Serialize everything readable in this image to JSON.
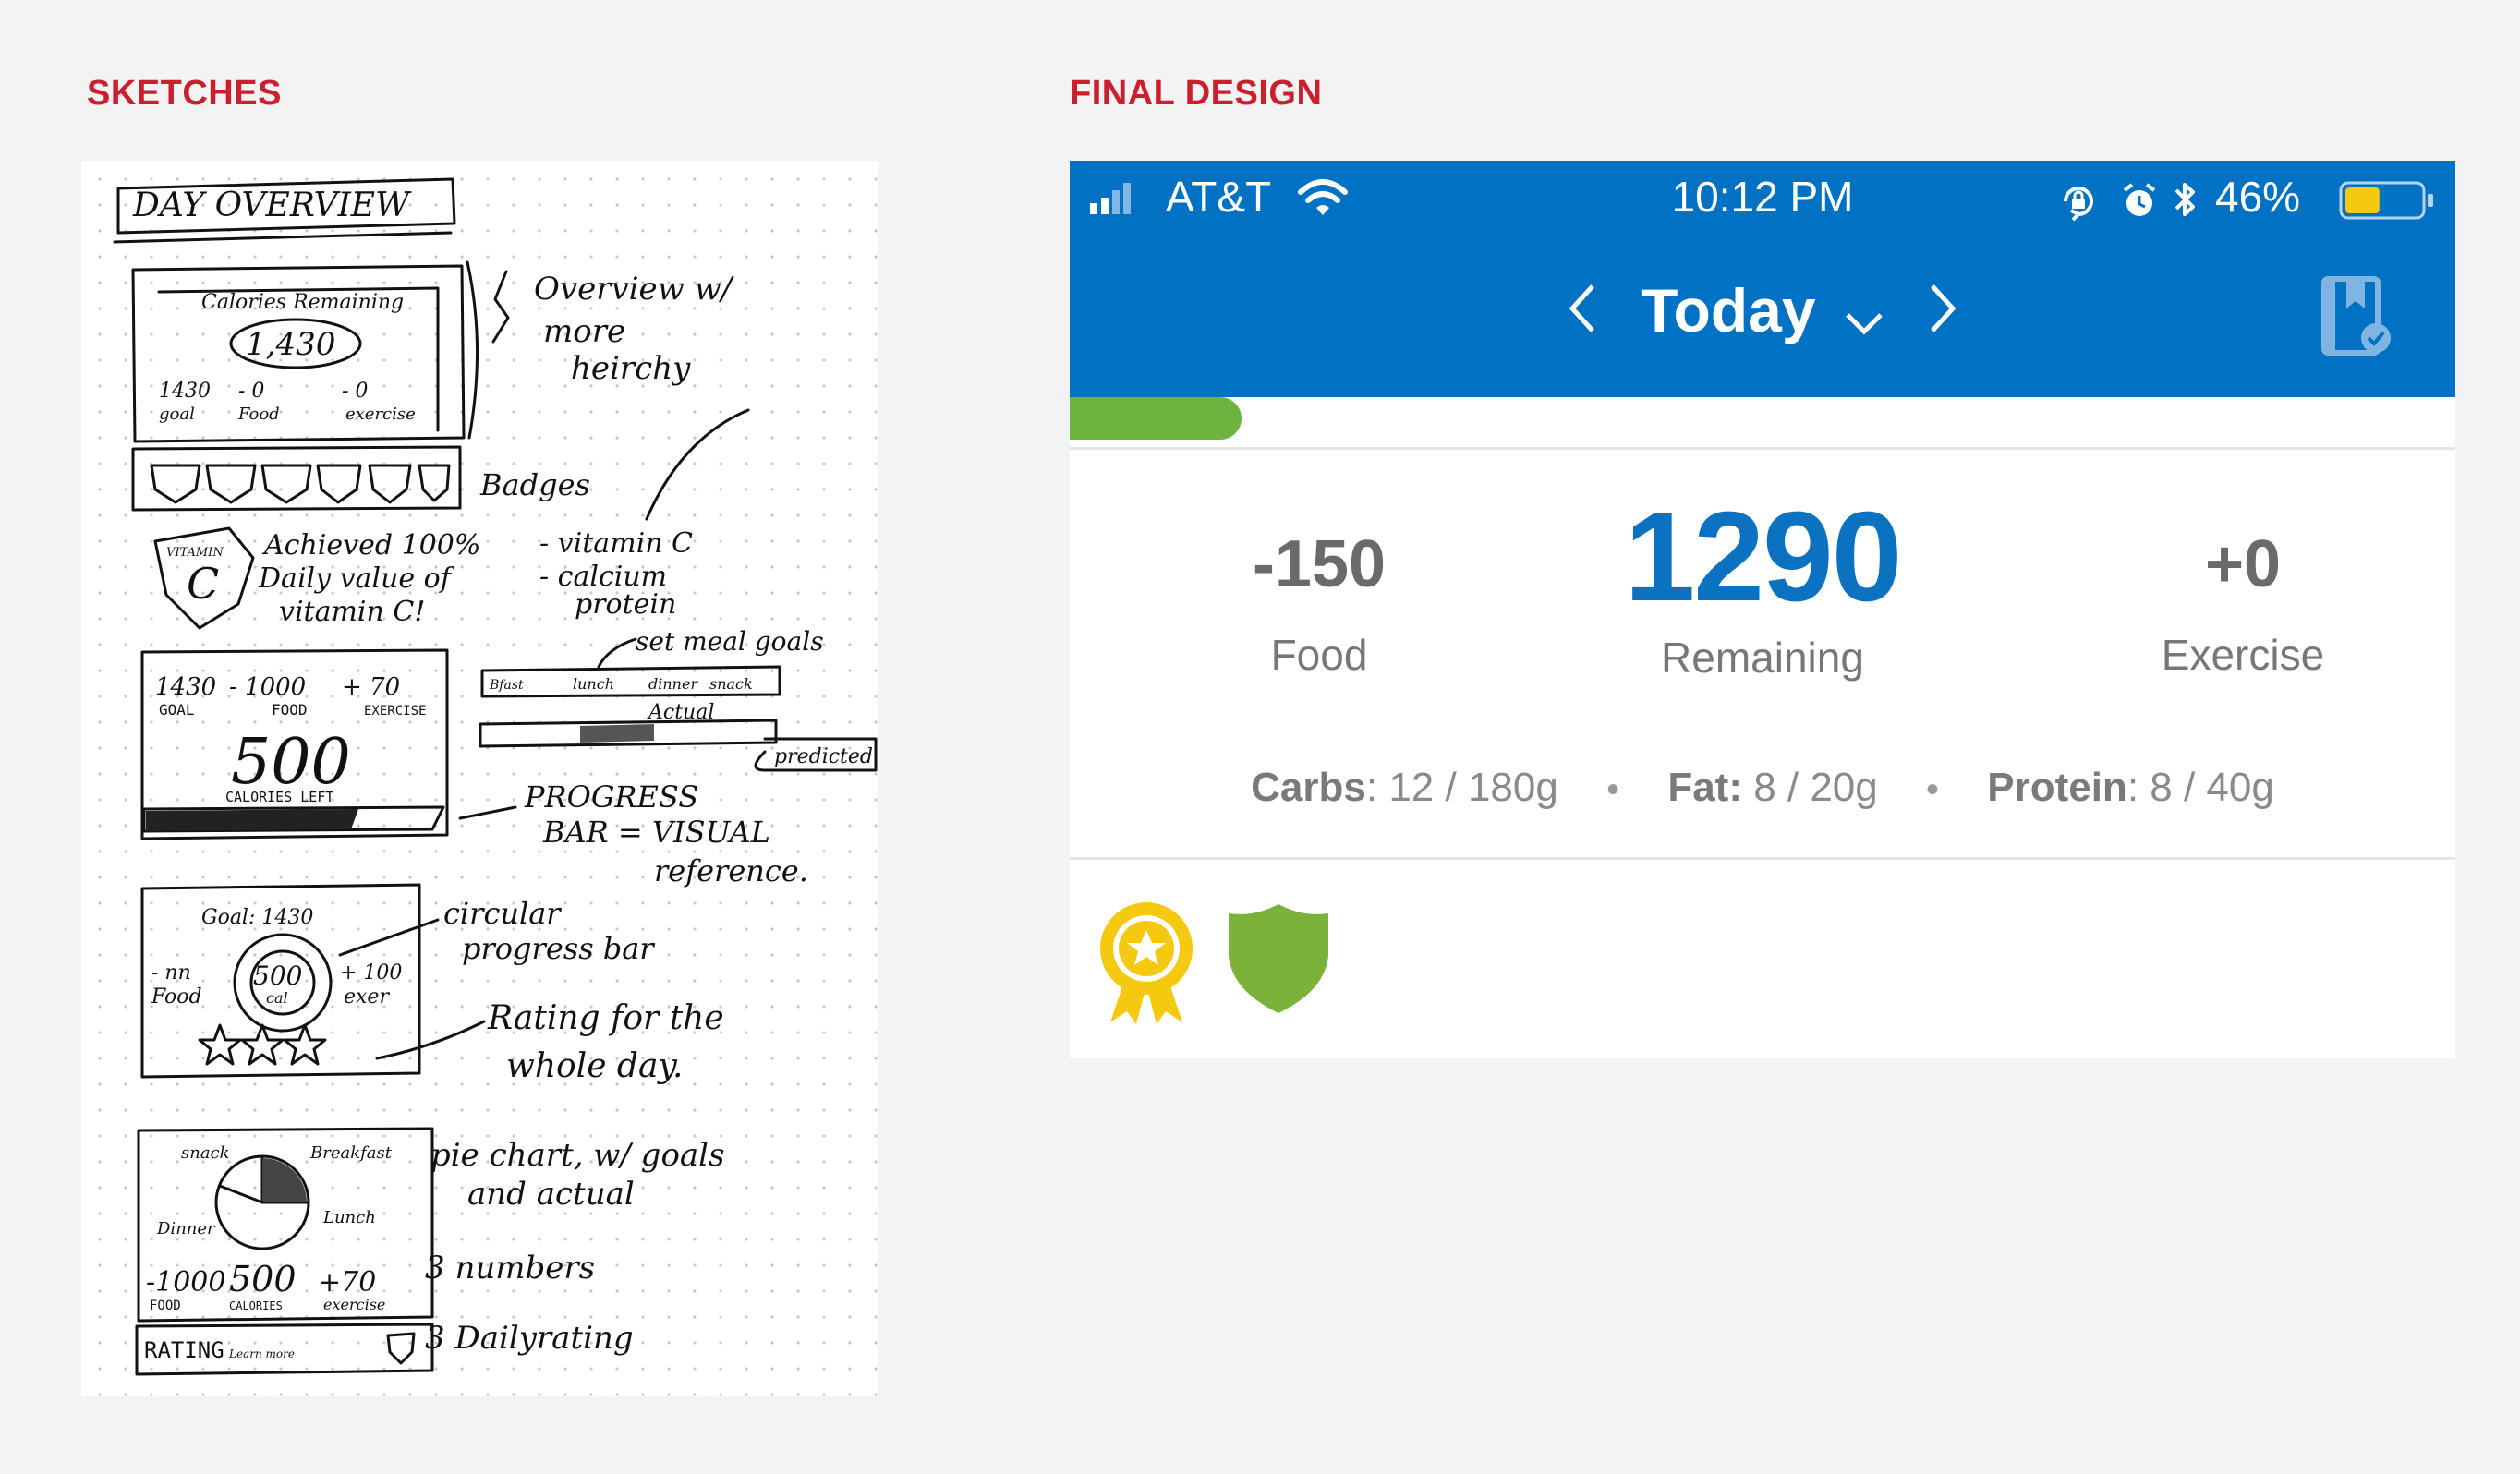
{
  "labels": {
    "sketches": "SKETCHES",
    "final_design": "FINAL DESIGN"
  },
  "sketch": {
    "title": "DAY OVERVIEW",
    "s1": {
      "label": "Calories Remaining",
      "value": "1,430",
      "goal": "1430",
      "goal_lbl": "goal",
      "food": "- 0",
      "food_lbl": "Food",
      "exercise": "- 0",
      "exercise_lbl": "exercise",
      "note1": "Overview w/",
      "note2": "more",
      "note3": "heirchy"
    },
    "badges": {
      "label": "Badges",
      "achieved1": "Achieved 100%",
      "achieved2": "Daily value of",
      "achieved3": "vitamin C!",
      "list1": "- vitamin C",
      "list2": "- calcium",
      "list3": "protein",
      "badge_text": "VITAMIN"
    },
    "s2": {
      "goal": "1430",
      "goal_lbl": "GOAL",
      "food": "- 1000",
      "food_lbl": "FOOD",
      "ex": "+ 70",
      "ex_lbl": "EXERCISE",
      "left": "500",
      "left_lbl": "CALORIES LEFT",
      "meal_note": "set meal goals",
      "bfast": "Bfast",
      "lunch": "lunch",
      "dinner": "dinner",
      "snack": "snack",
      "actual": "Actual",
      "predicted": "predicted",
      "pb1": "PROGRESS",
      "pb2": "BAR = VISUAL",
      "pb3": "reference."
    },
    "s3": {
      "goal": "Goal: 1430",
      "food": "- nn",
      "food_lbl": "Food",
      "center": "500",
      "center_lbl": "cal",
      "ex": "+ 100",
      "ex_lbl": "exer",
      "note1": "circular",
      "note2": "progress bar",
      "note3": "Rating for the",
      "note4": "whole day."
    },
    "s4": {
      "snack": "snack",
      "breakfast": "Breakfast",
      "dinner": "Dinner",
      "lunch": "Lunch",
      "food": "-1000",
      "food_lbl": "FOOD",
      "cal": "500",
      "cal_lbl": "CALORIES",
      "ex": "+70",
      "ex_lbl": "exercise",
      "rating": "RATING",
      "rating_sub": "Learn more",
      "note1": "pie chart, w/ goals",
      "note2": "and actual",
      "note3": "3 numbers",
      "note4": "3 Dailyrating"
    }
  },
  "status_bar": {
    "carrier": "AT&T",
    "time": "10:12 PM",
    "battery": "46%",
    "battery_level": 0.46
  },
  "nav": {
    "title": "Today"
  },
  "progress": {
    "fraction": 0.124
  },
  "stats": {
    "food_value": "-150",
    "food_label": "Food",
    "remaining_value": "1290",
    "remaining_label": "Remaining",
    "exercise_value": "+0",
    "exercise_label": "Exercise"
  },
  "macros": {
    "carbs_label": "Carbs",
    "carbs_value": ": 12 / 180g",
    "fat_label": "Fat:",
    "fat_value": " 8 / 20g",
    "protein_label": "Protein",
    "protein_value": ": 8 / 40g"
  },
  "colors": {
    "header": "#0071c3",
    "accent_blue": "#0a72c0",
    "progress_green": "#6db33f",
    "badge_gold": "#f5c90f",
    "shield_green": "#7bb33a",
    "label_red": "#cc1f2d"
  }
}
